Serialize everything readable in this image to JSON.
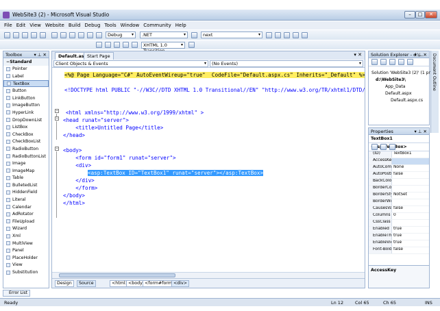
{
  "window": {
    "title": "WebSite3 (2) - Microsoft Visual Studio",
    "min": "–",
    "max": "□",
    "close": "✕"
  },
  "menu": [
    "File",
    "Edit",
    "View",
    "Website",
    "Build",
    "Debug",
    "Tools",
    "Window",
    "Community",
    "Help"
  ],
  "toolbar": {
    "config": "Debug",
    "platform": ".NET",
    "find": "next",
    "doctype": "XHTML 1.0 Transition."
  },
  "toolbox": {
    "title": "Toolbox",
    "items": [
      {
        "label": "Standard",
        "cat": true
      },
      {
        "label": "Pointer"
      },
      {
        "label": "Label"
      },
      {
        "label": "TextBox",
        "selected": true
      },
      {
        "label": "Button"
      },
      {
        "label": "LinkButton"
      },
      {
        "label": "ImageButton"
      },
      {
        "label": "HyperLink"
      },
      {
        "label": "DropDownList"
      },
      {
        "label": "ListBox"
      },
      {
        "label": "CheckBox"
      },
      {
        "label": "CheckBoxList"
      },
      {
        "label": "RadioButton"
      },
      {
        "label": "RadioButtonList"
      },
      {
        "label": "Image"
      },
      {
        "label": "ImageMap"
      },
      {
        "label": "Table"
      },
      {
        "label": "BulletedList"
      },
      {
        "label": "HiddenField"
      },
      {
        "label": "Literal"
      },
      {
        "label": "Calendar"
      },
      {
        "label": "AdRotator"
      },
      {
        "label": "FileUpload"
      },
      {
        "label": "Wizard"
      },
      {
        "label": "Xml"
      },
      {
        "label": "MultiView"
      },
      {
        "label": "Panel"
      },
      {
        "label": "PlaceHolder"
      },
      {
        "label": "View"
      },
      {
        "label": "Substitution"
      }
    ]
  },
  "editor": {
    "tabs": [
      "Default.aspx*",
      "Start Page"
    ],
    "left_combo": "Client Objects & Events",
    "right_combo": "(No Events)",
    "footer": {
      "design": "Design",
      "source": "Source",
      "crumbs": [
        "<html>",
        "<body>",
        "<form#form1>",
        "<div>"
      ]
    }
  },
  "code": {
    "l1": "<%@ Page Language=\"C#\" AutoEventWireup=\"true\"  CodeFile=\"Default.aspx.cs\" Inherits=\"_Default\" %>",
    "l2": "<!DOCTYPE html PUBLIC \"-//W3C//DTD XHTML 1.0 Transitional//EN\" \"http://www.w3.org/TR/xhtml1/DTD/xhtml1-transitional.dtd\">",
    "l3": "<html xmlns=\"http://www.w3.org/1999/xhtml\" >",
    "l4": "<head runat=\"server\">",
    "l5": "    <title>Untitled Page</title>",
    "l6": "</head>",
    "l7": "<body>",
    "l8": "    <form id=\"form1\" runat=\"server\">",
    "l9": "    <div>",
    "l10": "<asp:TextBox ID=\"TextBox1\" runat=\"server\"></asp:TextBox>",
    "l11": "    </div>",
    "l12": "    </form>",
    "l13": "</body>",
    "l14": "</html>"
  },
  "solution": {
    "title": "Solution Explorer - d:\\...",
    "items": [
      "Solution 'WebSite3 (2)' (1 proj",
      "d:\\WebSite3\\",
      "App_Data",
      "Default.aspx",
      "Default.aspx.cs"
    ]
  },
  "properties": {
    "title": "Properties",
    "object": "TextBox1 <asp:TextBox>",
    "rows": [
      [
        "(ID)",
        "TextBox1"
      ],
      [
        "AccessKey",
        ""
      ],
      [
        "AutoComplet",
        "None"
      ],
      [
        "AutoPostBac",
        "false"
      ],
      [
        "BackColor",
        ""
      ],
      [
        "BorderColor",
        ""
      ],
      [
        "BorderStyle",
        "NotSet"
      ],
      [
        "BorderWidth",
        ""
      ],
      [
        "CausesValida",
        "false"
      ],
      [
        "Columns",
        "0"
      ],
      [
        "CssClass",
        ""
      ],
      [
        "Enabled",
        "true"
      ],
      [
        "EnableThemi",
        "true"
      ],
      [
        "EnableViewSt",
        "true"
      ],
      [
        "Font-Bold",
        "false"
      ]
    ],
    "desc": "AccessKey"
  },
  "sidestrip": "Document Outline",
  "error_tab": "Error List",
  "status": {
    "ready": "Ready",
    "ln": "Ln 12",
    "col": "Col 65",
    "ch": "Ch 65",
    "ins": "INS"
  }
}
